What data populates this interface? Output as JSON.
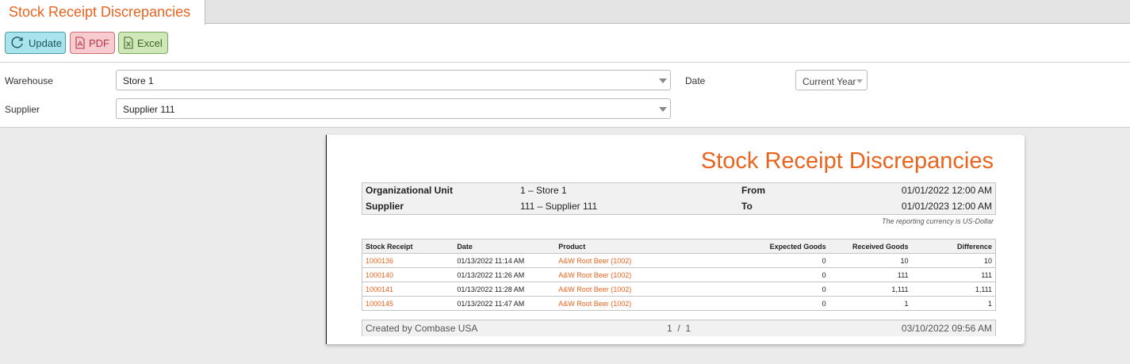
{
  "tab": {
    "title": "Stock Receipt Discrepancies"
  },
  "toolbar": {
    "update_label": "Update",
    "pdf_label": "PDF",
    "excel_label": "Excel"
  },
  "filters": {
    "warehouse_label": "Warehouse",
    "warehouse_value": "Store 1",
    "supplier_label": "Supplier",
    "supplier_value": "Supplier 111",
    "date_label": "Date",
    "date_value": "Current Year"
  },
  "report": {
    "title": "Stock Receipt Discrepancies",
    "org_unit_label": "Organizational Unit",
    "org_unit_value": "1 – Store 1",
    "supplier_label": "Supplier",
    "supplier_value": "111 – Supplier 111",
    "from_label": "From",
    "from_value": "01/01/2022 12:00 AM",
    "to_label": "To",
    "to_value": "01/01/2023 12:00 AM",
    "currency_note": "The reporting currency is US-Dollar",
    "columns": [
      "Stock Receipt",
      "Date",
      "Product",
      "Expected Goods",
      "Received Goods",
      "Difference"
    ],
    "rows": [
      {
        "receipt": "1000136",
        "date": "01/13/2022 11:14 AM",
        "product": "A&W Root Beer (1002)",
        "expected": "0",
        "received": "10",
        "difference": "10"
      },
      {
        "receipt": "1000140",
        "date": "01/13/2022 11:26 AM",
        "product": "A&W Root Beer (1002)",
        "expected": "0",
        "received": "111",
        "difference": "111"
      },
      {
        "receipt": "1000141",
        "date": "01/13/2022 11:28 AM",
        "product": "A&W Root Beer (1002)",
        "expected": "0",
        "received": "1,111",
        "difference": "1,111"
      },
      {
        "receipt": "1000145",
        "date": "01/13/2022 11:47 AM",
        "product": "A&W Root Beer (1002)",
        "expected": "0",
        "received": "1",
        "difference": "1"
      }
    ],
    "footer": {
      "created_by": "Created by Combase USA",
      "page": "1  /  1",
      "timestamp": "03/10/2022 09:56 AM"
    }
  },
  "colors": {
    "accent": "#e8641f"
  }
}
